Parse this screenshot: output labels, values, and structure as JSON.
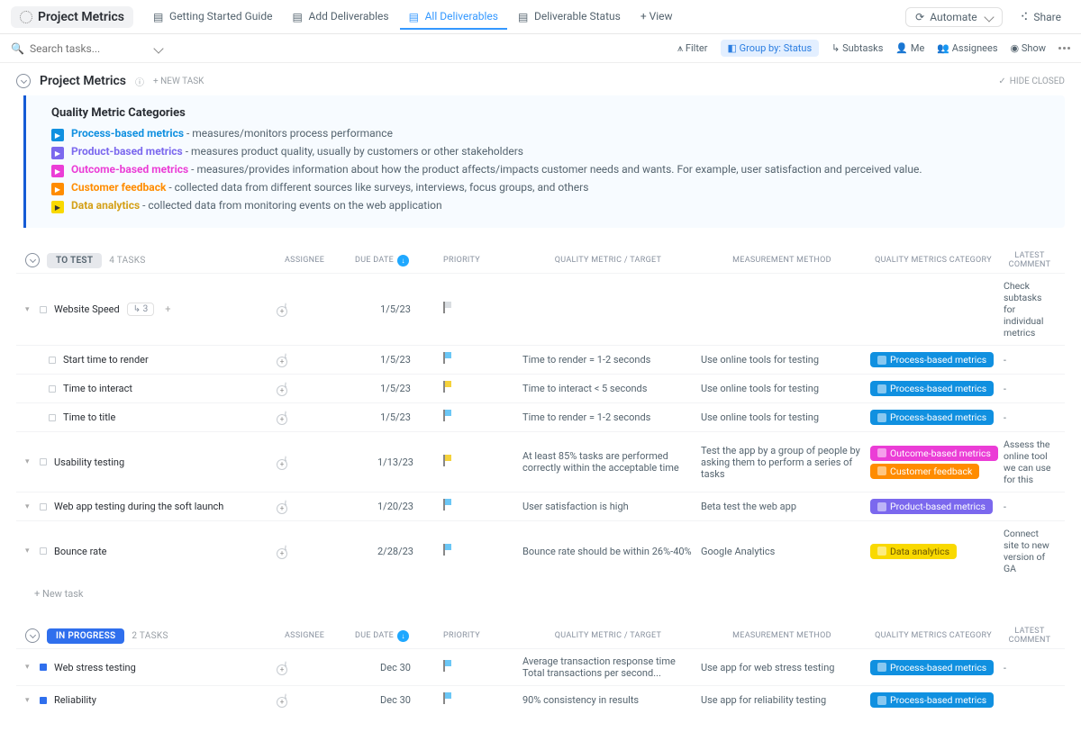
{
  "header": {
    "title": "Project Metrics",
    "tabs": [
      {
        "label": "Getting Started Guide"
      },
      {
        "label": "Add Deliverables"
      },
      {
        "label": "All Deliverables",
        "active": true
      },
      {
        "label": "Deliverable Status"
      },
      {
        "label": "+ View"
      }
    ],
    "automate": "Automate",
    "share": "Share"
  },
  "toolbar": {
    "search_placeholder": "Search tasks...",
    "filter": "Filter",
    "group_by": "Group by: Status",
    "subtasks": "Subtasks",
    "me": "Me",
    "assignees": "Assignees",
    "show": "Show"
  },
  "page": {
    "title": "Project Metrics",
    "new_task": "+ NEW TASK",
    "hide_closed": "HIDE CLOSED"
  },
  "categories": {
    "title": "Quality Metric Categories",
    "items": [
      {
        "color": "blue",
        "label": "Process-based metrics",
        "desc": " - measures/monitors process performance"
      },
      {
        "color": "purple",
        "label": "Product-based metrics",
        "desc": " - measures product quality, usually by  customers or other stakeholders"
      },
      {
        "color": "pink",
        "label": "Outcome-based metrics",
        "desc": " - measures/provides information about how the product affects/impacts customer needs and wants. For example, user satisfaction and perceived value."
      },
      {
        "color": "orange",
        "label": "Customer feedback",
        "desc": " - collected data from different sources like surveys, interviews, focus groups, and others"
      },
      {
        "color": "yellow",
        "label": "Data analytics",
        "desc": " - collected data from monitoring events on the web application"
      }
    ]
  },
  "columns": {
    "assignee": "ASSIGNEE",
    "due": "DUE DATE",
    "priority": "PRIORITY",
    "metric": "QUALITY METRIC / TARGET",
    "method": "MEASUREMENT METHOD",
    "category": "QUALITY METRICS CATEGORY",
    "comment": "LATEST COMMENT"
  },
  "groups": [
    {
      "status": "TO TEST",
      "status_class": "st-test",
      "count": "4 TASKS",
      "rows": [
        {
          "name": "Website Speed",
          "sub": "3",
          "due": "1/5/23",
          "flag": "grey",
          "metric": "",
          "method": "",
          "cats": [],
          "comment": "Check subtasks for individual metrics"
        },
        {
          "name": "Start time to render",
          "indent": true,
          "due": "1/5/23",
          "flag": "blue",
          "metric": "Time to render = 1-2 seconds",
          "method": "Use online tools for testing",
          "cats": [
            {
              "c": "blue",
              "t": "Process-based metrics"
            }
          ],
          "comment": "-"
        },
        {
          "name": "Time to interact",
          "indent": true,
          "due": "1/5/23",
          "flag": "yellow",
          "metric": "Time to interact < 5 seconds",
          "method": "Use online tools for testing",
          "cats": [
            {
              "c": "blue",
              "t": "Process-based metrics"
            }
          ],
          "comment": "-"
        },
        {
          "name": "Time to title",
          "indent": true,
          "due": "1/5/23",
          "flag": "blue",
          "metric": "Time to render = 1-2 seconds",
          "method": "Use online tools for testing",
          "cats": [
            {
              "c": "blue",
              "t": "Process-based metrics"
            }
          ],
          "comment": "-"
        },
        {
          "name": "Usability testing",
          "due": "1/13/23",
          "flag": "yellow",
          "metric": "At least 85% tasks are performed correctly within the acceptable time",
          "method": "Test the app by a group of people by asking them to perform a series of tasks",
          "cats": [
            {
              "c": "pink",
              "t": "Outcome-based metrics"
            },
            {
              "c": "orange",
              "t": "Customer feedback"
            }
          ],
          "comment": "Assess the online tool we can use for this"
        },
        {
          "name": "Web app testing during the soft launch",
          "due": "1/20/23",
          "flag": "blue",
          "metric": "User satisfaction is high",
          "method": "Beta test the web app",
          "cats": [
            {
              "c": "purple",
              "t": "Product-based metrics"
            }
          ],
          "comment": "-"
        },
        {
          "name": "Bounce rate",
          "due": "2/28/23",
          "flag": "blue",
          "metric": "Bounce rate should be within 26%-40%",
          "method": "Google Analytics",
          "cats": [
            {
              "c": "yellow",
              "t": "Data analytics"
            }
          ],
          "comment": "Connect site to new version of GA"
        }
      ],
      "new_task": "+ New task"
    },
    {
      "status": "IN PROGRESS",
      "status_class": "st-prog",
      "count": "2 TASKS",
      "rows": [
        {
          "name": "Web stress testing",
          "square": "blue",
          "due": "Dec 30",
          "flag": "blue",
          "metric": "Average transaction response time\nTotal transactions per second...",
          "method": "Use app for web stress testing",
          "cats": [
            {
              "c": "blue",
              "t": "Process-based metrics"
            }
          ],
          "comment": "-"
        },
        {
          "name": "Reliability",
          "square": "blue",
          "due": "Dec 30",
          "flag": "blue",
          "metric": "90% consistency in results",
          "method": "Use app for reliability testing",
          "cats": [
            {
              "c": "blue",
              "t": "Process-based metrics"
            }
          ],
          "comment": ""
        }
      ]
    }
  ]
}
